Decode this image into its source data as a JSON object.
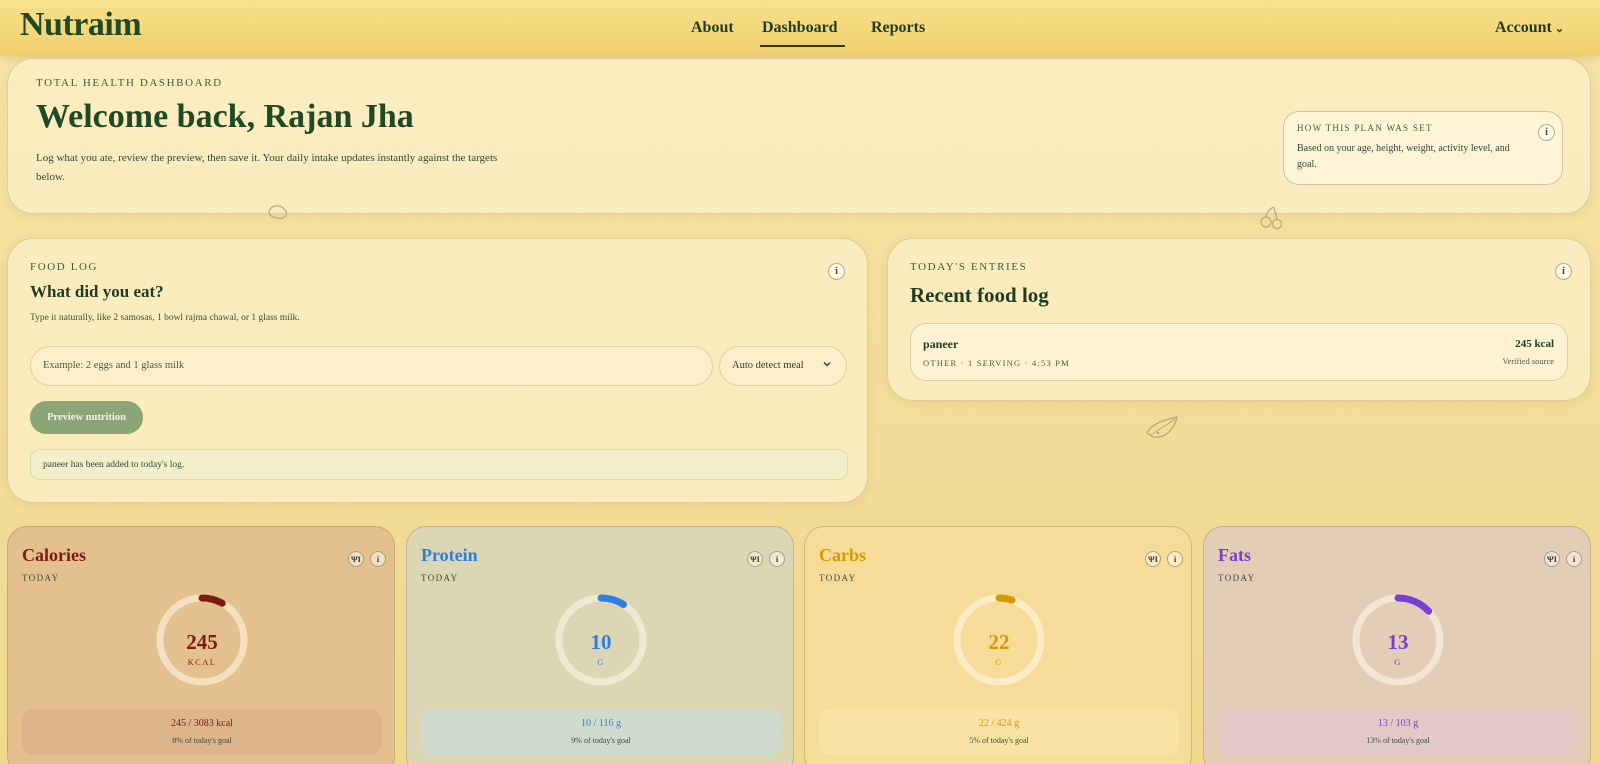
{
  "app": {
    "brand": "Nutraim",
    "nav": [
      "About",
      "Dashboard",
      "Reports"
    ],
    "active_nav": "Dashboard",
    "account_label": "Account"
  },
  "hero": {
    "eyebrow": "TOTAL HEALTH DASHBOARD",
    "title": "Welcome back, Rajan Jha",
    "description": "Log what you ate, review the preview, then save it. Your daily intake updates instantly against the targets below.",
    "plan": {
      "eyebrow": "HOW THIS PLAN WAS SET",
      "text": "Based on your age, height, weight, activity level, and goal."
    }
  },
  "food_log": {
    "eyebrow": "FOOD LOG",
    "title": "What did you eat?",
    "hint": "Type it naturally, like 2 samosas, 1 bowl rajma chawal, or 1 glass milk.",
    "input_placeholder": "Example: 2 eggs and 1 glass milk",
    "input_value": "",
    "meal_select": "Auto detect meal",
    "preview_button": "Preview nutrition",
    "toast": "paneer has been added to today's log."
  },
  "entries": {
    "eyebrow": "TODAY'S ENTRIES",
    "title": "Recent food log",
    "items": [
      {
        "name": "paneer",
        "meta": "OTHER · 1 SERVING · 4:53 PM",
        "kcal": "245 kcal",
        "source": "Verified source"
      }
    ]
  },
  "macros": [
    {
      "name": "Calories",
      "period": "TODAY",
      "value": "245",
      "unit": "KCAL",
      "ratio": "245 / 3083 kcal",
      "pct_text": "8% of today's goal",
      "progress": 0.08,
      "accent": "#7a1d0e",
      "card_bg": "#e3c08e",
      "foot_bg": "#dcb58a"
    },
    {
      "name": "Protein",
      "period": "TODAY",
      "value": "10",
      "unit": "G",
      "ratio": "10 / 116 g",
      "pct_text": "9% of today's goal",
      "progress": 0.09,
      "accent": "#2f7fe0",
      "card_bg": "#dcd6b4",
      "foot_bg": "#cfdccd"
    },
    {
      "name": "Carbs",
      "period": "TODAY",
      "value": "22",
      "unit": "G",
      "ratio": "22 / 424 g",
      "pct_text": "5% of today's goal",
      "progress": 0.05,
      "accent": "#d49a00",
      "card_bg": "#f6dc98",
      "foot_bg": "#f9e3a4"
    },
    {
      "name": "Fats",
      "period": "TODAY",
      "value": "13",
      "unit": "G",
      "ratio": "13 / 103 g",
      "pct_text": "13% of today's goal",
      "progress": 0.13,
      "accent": "#7a3fd0",
      "card_bg": "#e4cdb6",
      "foot_bg": "#e3c9c5"
    }
  ],
  "icons": {
    "info": "info-icon",
    "fork": "fork-knife-icon",
    "chevron": "chevron-down-icon"
  }
}
